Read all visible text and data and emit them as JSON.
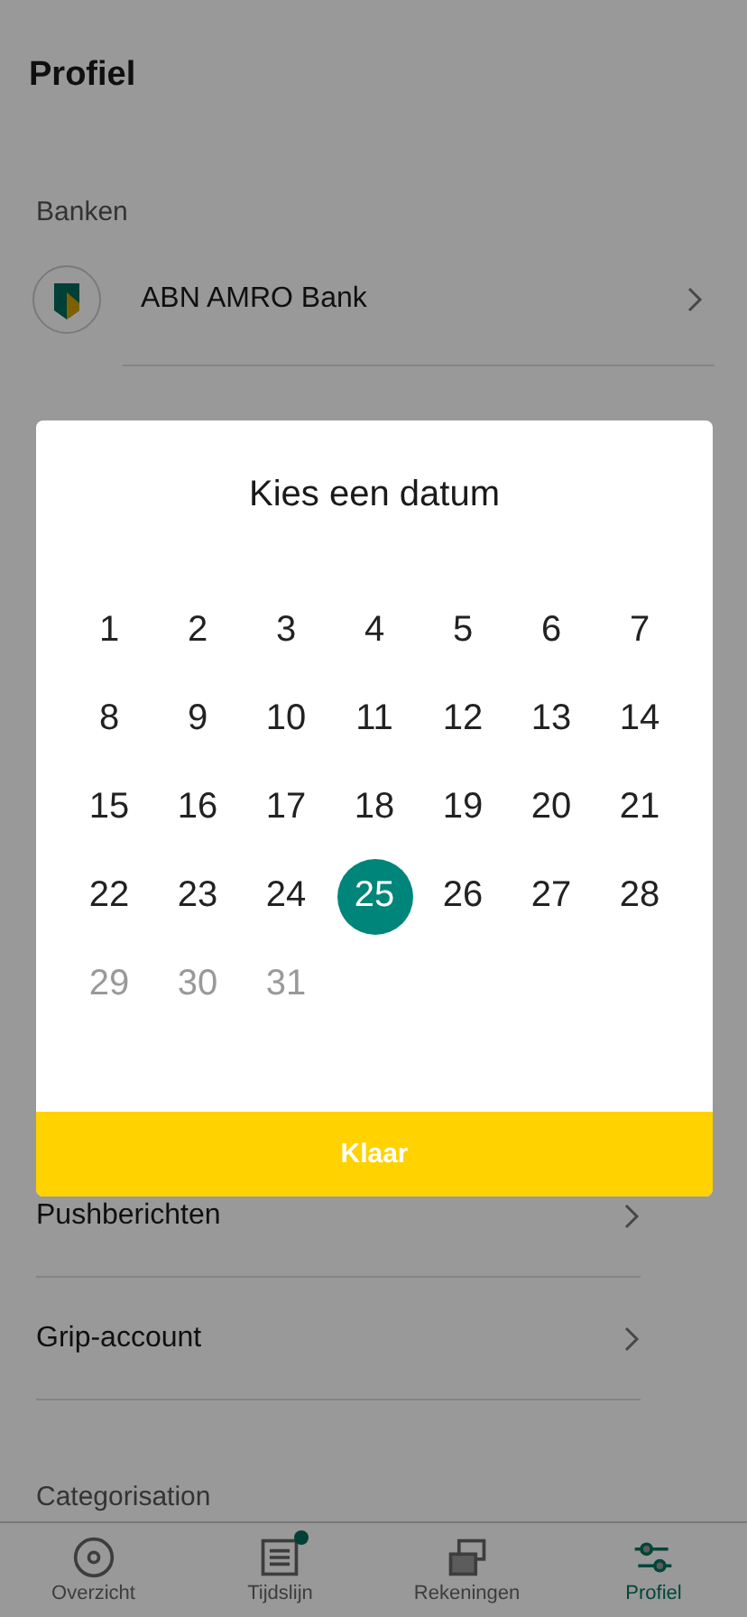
{
  "header": {
    "title": "Profiel"
  },
  "banks": {
    "heading": "Banken",
    "items": [
      {
        "name": "ABN AMRO Bank"
      }
    ]
  },
  "settings": [
    {
      "label": "Pushberichten"
    },
    {
      "label": "Grip-account"
    }
  ],
  "next_section": {
    "heading": "Categorisation"
  },
  "date_picker": {
    "title": "Kies een datum",
    "days": [
      {
        "label": "1",
        "selected": false,
        "disabled": false
      },
      {
        "label": "2",
        "selected": false,
        "disabled": false
      },
      {
        "label": "3",
        "selected": false,
        "disabled": false
      },
      {
        "label": "4",
        "selected": false,
        "disabled": false
      },
      {
        "label": "5",
        "selected": false,
        "disabled": false
      },
      {
        "label": "6",
        "selected": false,
        "disabled": false
      },
      {
        "label": "7",
        "selected": false,
        "disabled": false
      },
      {
        "label": "8",
        "selected": false,
        "disabled": false
      },
      {
        "label": "9",
        "selected": false,
        "disabled": false
      },
      {
        "label": "10",
        "selected": false,
        "disabled": false
      },
      {
        "label": "11",
        "selected": false,
        "disabled": false
      },
      {
        "label": "12",
        "selected": false,
        "disabled": false
      },
      {
        "label": "13",
        "selected": false,
        "disabled": false
      },
      {
        "label": "14",
        "selected": false,
        "disabled": false
      },
      {
        "label": "15",
        "selected": false,
        "disabled": false
      },
      {
        "label": "16",
        "selected": false,
        "disabled": false
      },
      {
        "label": "17",
        "selected": false,
        "disabled": false
      },
      {
        "label": "18",
        "selected": false,
        "disabled": false
      },
      {
        "label": "19",
        "selected": false,
        "disabled": false
      },
      {
        "label": "20",
        "selected": false,
        "disabled": false
      },
      {
        "label": "21",
        "selected": false,
        "disabled": false
      },
      {
        "label": "22",
        "selected": false,
        "disabled": false
      },
      {
        "label": "23",
        "selected": false,
        "disabled": false
      },
      {
        "label": "24",
        "selected": false,
        "disabled": false
      },
      {
        "label": "25",
        "selected": true,
        "disabled": false
      },
      {
        "label": "26",
        "selected": false,
        "disabled": false
      },
      {
        "label": "27",
        "selected": false,
        "disabled": false
      },
      {
        "label": "28",
        "selected": false,
        "disabled": false
      },
      {
        "label": "29",
        "selected": false,
        "disabled": true
      },
      {
        "label": "30",
        "selected": false,
        "disabled": true
      },
      {
        "label": "31",
        "selected": false,
        "disabled": true
      }
    ],
    "button": "Klaar"
  },
  "tab_bar": [
    {
      "label": "Overzicht",
      "selected": false,
      "badge": false
    },
    {
      "label": "Tijdslijn",
      "selected": false,
      "badge": true
    },
    {
      "label": "Rekeningen",
      "selected": false,
      "badge": false
    },
    {
      "label": "Profiel",
      "selected": true,
      "badge": false
    }
  ]
}
